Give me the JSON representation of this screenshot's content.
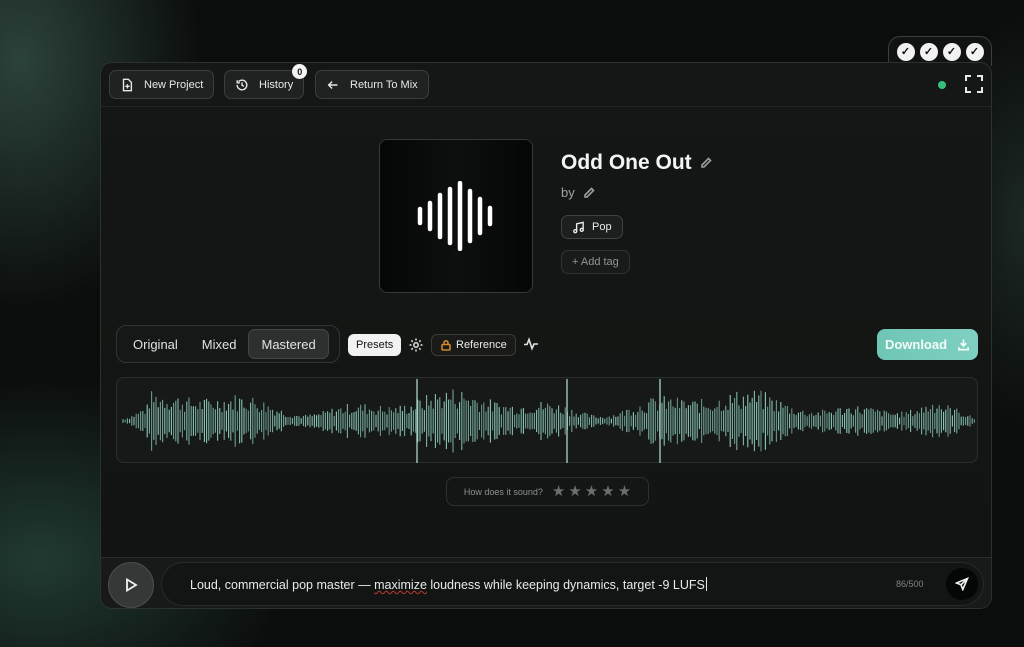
{
  "header": {
    "new_project": "New Project",
    "history": "History",
    "history_count": "0",
    "return_to_mix": "Return To Mix"
  },
  "status_checks": [
    "✓",
    "✓",
    "✓",
    "✓"
  ],
  "track": {
    "title": "Odd One Out",
    "by_label": "by",
    "genre_tag": "Pop",
    "add_tag": "+ Add tag"
  },
  "versions": {
    "tabs": [
      "Original",
      "Mixed",
      "Mastered"
    ],
    "selected": "Mastered"
  },
  "tools": {
    "presets": "Presets",
    "reference": "Reference",
    "download": "Download"
  },
  "rating": {
    "question": "How does it sound?",
    "stars_total": 5,
    "stars_filled": 0
  },
  "prompt": {
    "text_before": "Loud, commercial pop master — ",
    "text_misspelled": "maximize",
    "text_after": " loudness while keeping dynamics, target -9 LUFS",
    "counter": "86/500"
  },
  "colors": {
    "accent": "#7fd0c1",
    "waveform": "#8fcdbd",
    "online": "#32c07a",
    "reference_lock": "#d08a2c"
  },
  "icons": {
    "new_project": "file-plus-icon",
    "history": "history-icon",
    "return": "arrow-left-icon",
    "fullscreen": "fullscreen-icon",
    "genre": "music-note-icon",
    "settings": "gear-icon",
    "reference": "lock-icon",
    "analysis": "pulse-icon",
    "download": "download-icon",
    "play": "play-icon",
    "send": "send-icon"
  }
}
